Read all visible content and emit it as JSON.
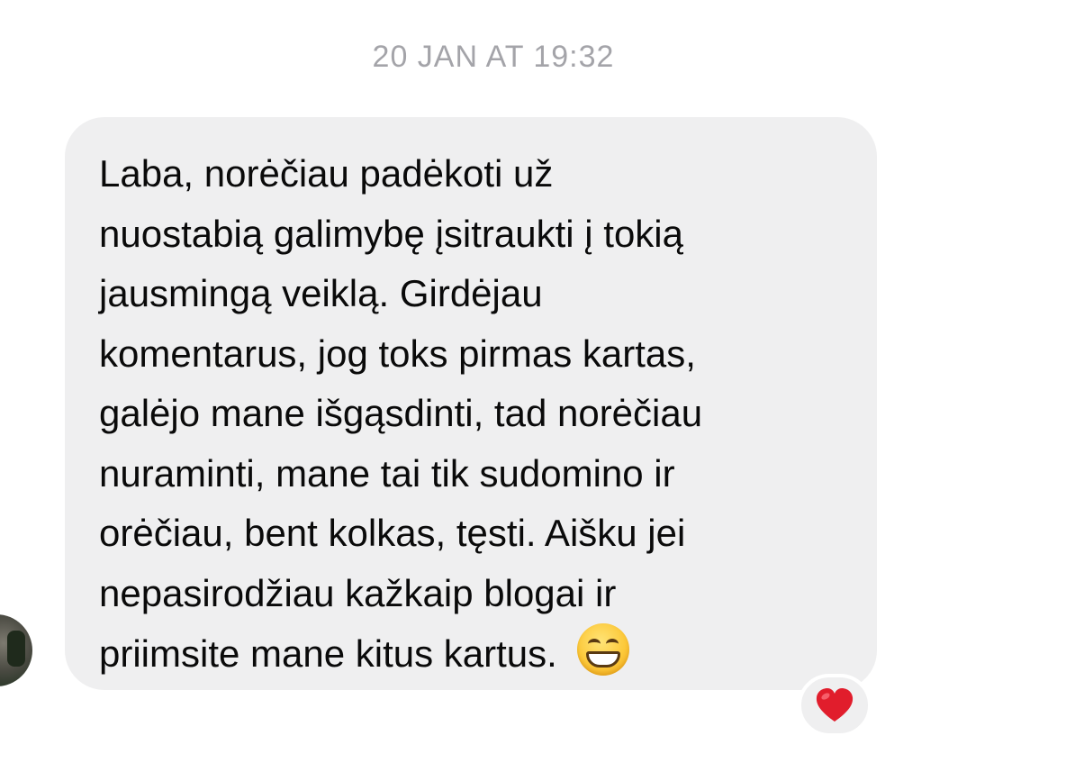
{
  "conversation": {
    "timestamp": "20 JAN AT 19:32"
  },
  "message": {
    "sender": "incoming",
    "text": "Laba, norėčiau padėkoti už\nnuostabią galimybę įsitraukti į tokią\njausmingą veiklą. Girdėjau\nkomentarus, jog toks pirmas kartas,\ngalėjo mane išgąsdinti, tad norėčiau\nnuraminti, mane tai tik sudomino ir\norėčiau, bent kolkas, tęsti. Aišku jei\nnepasirodžiau kažkaip blogai ir\npriimsite mane kitus kartus.",
    "emoji": "grinning-face-with-smiling-eyes",
    "bubble_color": "#efeff0"
  },
  "reaction": {
    "icon": "red-heart-icon",
    "color": "#e11d2c"
  },
  "avatar": {
    "icon": "contact-avatar"
  }
}
